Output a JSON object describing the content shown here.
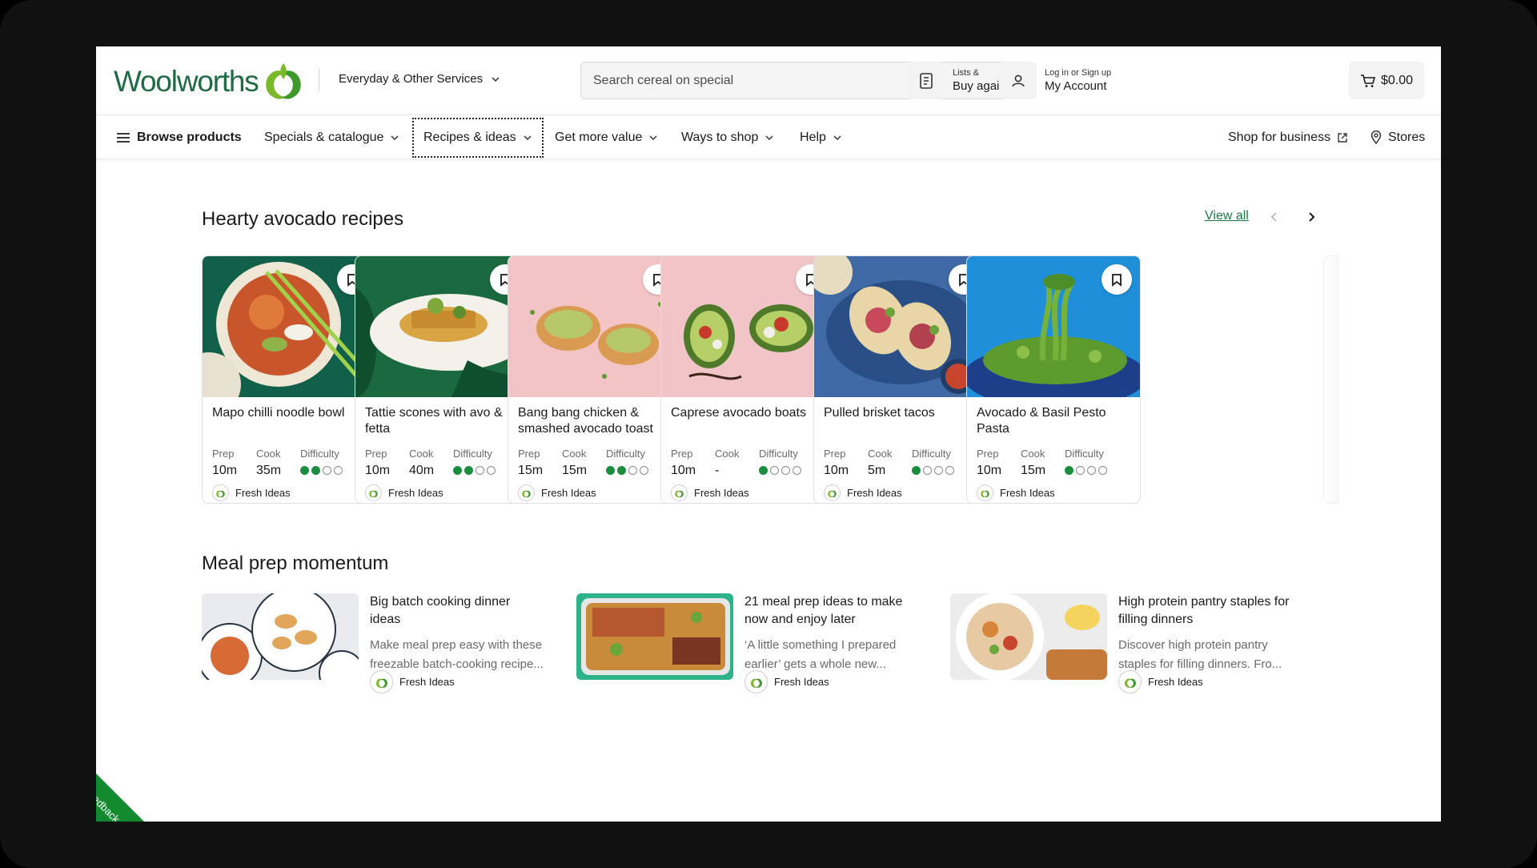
{
  "header": {
    "logo_text": "Woolworths",
    "services_label": "Everyday & Other Services",
    "search_placeholder": "Search cereal on special",
    "lists": {
      "small": "Lists &",
      "big": "Buy again"
    },
    "account": {
      "small": "Log in or Sign up",
      "big": "My Account"
    },
    "cart_total": "$0.00"
  },
  "nav": {
    "browse": "Browse products",
    "items": [
      {
        "label": "Specials & catalogue"
      },
      {
        "label": "Recipes & ideas"
      },
      {
        "label": "Get more value"
      },
      {
        "label": "Ways to shop"
      },
      {
        "label": "Help"
      }
    ],
    "shop_business": "Shop for business",
    "stores": "Stores"
  },
  "recipes_section": {
    "title": "Hearty avocado recipes",
    "view_all": "View all",
    "labels": {
      "prep": "Prep",
      "cook": "Cook",
      "difficulty": "Difficulty"
    },
    "brand": "Fresh Ideas",
    "cards": [
      {
        "title": "Mapo chilli noodle bowl",
        "prep": "10m",
        "cook": "35m",
        "difficulty": 2
      },
      {
        "title": "Tattie scones with avo & fetta",
        "prep": "10m",
        "cook": "40m",
        "difficulty": 2
      },
      {
        "title": "Bang bang chicken & smashed avocado toast",
        "prep": "15m",
        "cook": "15m",
        "difficulty": 2
      },
      {
        "title": "Caprese avocado boats",
        "prep": "10m",
        "cook": "-",
        "difficulty": 1
      },
      {
        "title": "Pulled brisket tacos",
        "prep": "10m",
        "cook": "5m",
        "difficulty": 1
      },
      {
        "title": "Avocado & Basil Pesto Pasta",
        "prep": "10m",
        "cook": "15m",
        "difficulty": 1
      }
    ]
  },
  "meal_prep_section": {
    "title": "Meal prep momentum",
    "brand": "Fresh Ideas",
    "articles": [
      {
        "title": "Big batch cooking dinner ideas",
        "desc": "Make meal prep easy with these freezable batch-cooking recipe..."
      },
      {
        "title": "21 meal prep ideas to make now and enjoy later",
        "desc": "‘A little something I prepared earlier’ gets a whole new..."
      },
      {
        "title": "High protein pantry staples for filling dinners",
        "desc": "Discover high protein pantry staples for filling dinners. Fro..."
      }
    ]
  },
  "feedback_label": "Feedback",
  "colors": {
    "brand_green": "#1f6b45",
    "accent_green": "#188e3e",
    "feedback_green": "#148a2f"
  }
}
